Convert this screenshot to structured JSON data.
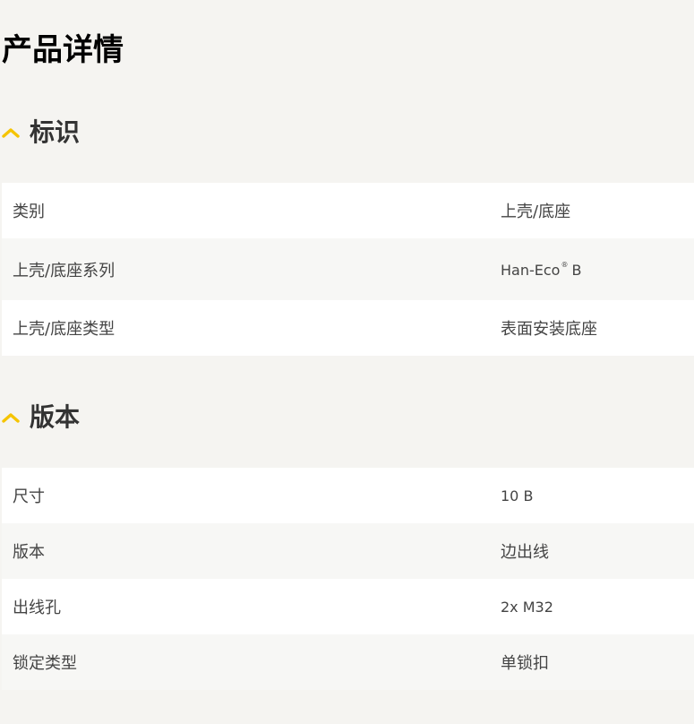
{
  "page": {
    "title": "产品详情"
  },
  "sections": [
    {
      "title": "标识",
      "rows": [
        {
          "label": "类别",
          "value": "上壳/底座"
        },
        {
          "label": "上壳/底座系列",
          "value": "Han-Eco",
          "value_sup": "®",
          "value_suffix": "B"
        },
        {
          "label": "上壳/底座类型",
          "value": "表面安装底座"
        }
      ]
    },
    {
      "title": "版本",
      "rows": [
        {
          "label": "尺寸",
          "value": "10 B"
        },
        {
          "label": "版本",
          "value": "边出线"
        },
        {
          "label": "出线孔",
          "value": "2x M32"
        },
        {
          "label": "锁定类型",
          "value": "单锁扣"
        }
      ]
    }
  ],
  "icons": {
    "section_toggle": "chevron-up-icon"
  },
  "colors": {
    "accent": "#f5c400",
    "background": "#f5f4f1",
    "row_white": "#ffffff",
    "row_grey": "#f7f7f5",
    "text": "#444444"
  }
}
